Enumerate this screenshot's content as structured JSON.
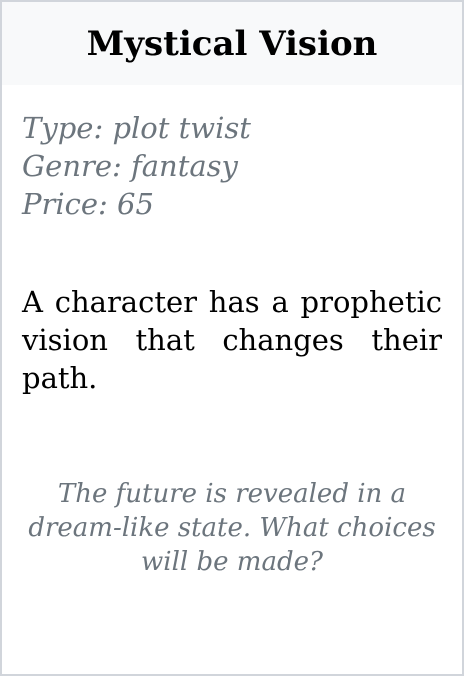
{
  "card": {
    "title": "Mystical Vision",
    "type_line": "Type: plot twist",
    "genre_line": "Genre: fantasy",
    "price_line": "Price: 65",
    "description": "A character has a prophetic vision that changes their path.",
    "tagline": "The future is revealed in a dream-like state. What choices will be made?"
  },
  "colors": {
    "header_bg": "#f8f9fa",
    "border": "#d1d5db",
    "muted_text": "#6c757d",
    "body_text": "#000000"
  }
}
